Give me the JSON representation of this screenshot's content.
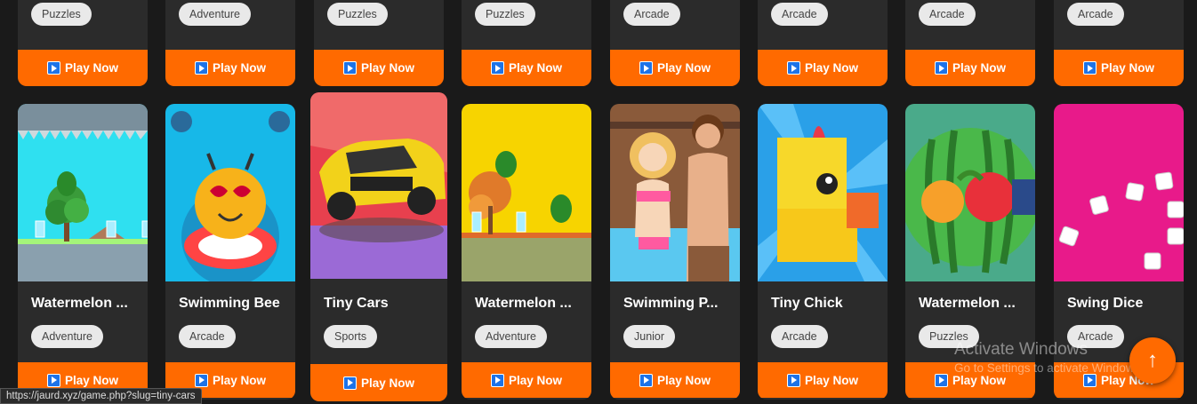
{
  "top_row": [
    {
      "tag": "Puzzles",
      "button": "Play Now"
    },
    {
      "tag": "Adventure",
      "button": "Play Now"
    },
    {
      "tag": "Puzzles",
      "button": "Play Now"
    },
    {
      "tag": "Puzzles",
      "button": "Play Now"
    },
    {
      "tag": "Arcade",
      "button": "Play Now"
    },
    {
      "tag": "Arcade",
      "button": "Play Now"
    },
    {
      "tag": "Arcade",
      "button": "Play Now"
    },
    {
      "tag": "Arcade",
      "button": "Play Now"
    }
  ],
  "games": [
    {
      "title": "Watermelon ...",
      "tag": "Adventure",
      "button": "Play Now",
      "icon": "watermelon-level-thumbnail"
    },
    {
      "title": "Swimming Bee",
      "tag": "Arcade",
      "button": "Play Now",
      "icon": "swimming-bee-thumbnail"
    },
    {
      "title": "Tiny Cars",
      "tag": "Sports",
      "button": "Play Now",
      "icon": "tiny-cars-thumbnail"
    },
    {
      "title": "Watermelon ...",
      "tag": "Adventure",
      "button": "Play Now",
      "icon": "watermelon-yellow-thumbnail"
    },
    {
      "title": "Swimming P...",
      "tag": "Junior",
      "button": "Play Now",
      "icon": "swimming-couple-thumbnail"
    },
    {
      "title": "Tiny Chick",
      "tag": "Arcade",
      "button": "Play Now",
      "icon": "tiny-chick-thumbnail"
    },
    {
      "title": "Watermelon ...",
      "tag": "Puzzles",
      "button": "Play Now",
      "icon": "watermelon-fruit-thumbnail"
    },
    {
      "title": "Swing Dice",
      "tag": "Arcade",
      "button": "Play Now",
      "icon": "swing-dice-thumbnail"
    }
  ],
  "status_url": "https://jaurd.xyz/game.php?slug=tiny-cars",
  "watermark": {
    "line1": "Activate Windows",
    "line2": "Go to Settings to activate Windows."
  },
  "scroll_top": "↑",
  "colors": {
    "accent": "#ff6a00",
    "card": "#2b2b2b",
    "background": "#1a1a1a"
  }
}
